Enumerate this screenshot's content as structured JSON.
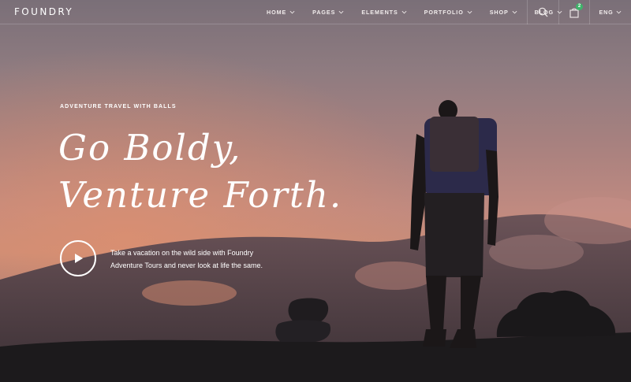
{
  "brand": {
    "logo": "FOUNDRY"
  },
  "nav": {
    "items": [
      {
        "label": "HOME"
      },
      {
        "label": "PAGES"
      },
      {
        "label": "ELEMENTS"
      },
      {
        "label": "PORTFOLIO"
      },
      {
        "label": "SHOP"
      },
      {
        "label": "BLOG"
      }
    ],
    "cart_count": "2",
    "language": "ENG",
    "icons": {
      "search": "search-icon",
      "cart": "shopping-bag-icon",
      "dropdown": "chevron-down-icon"
    }
  },
  "hero": {
    "eyebrow": "ADVENTURE TRAVEL WITH BALLS",
    "headline_line1": "Go Boldy,",
    "headline_line2": "Venture Forth.",
    "tagline": "Take a vacation on the wild side with Foundry Adventure Tours and never look at life the same.",
    "play_icon": "play-icon"
  },
  "colors": {
    "text": "#ffffff",
    "badge": "#3fb36a",
    "sky_warm": "#c98d78",
    "sky_cool": "#7a6f78"
  }
}
